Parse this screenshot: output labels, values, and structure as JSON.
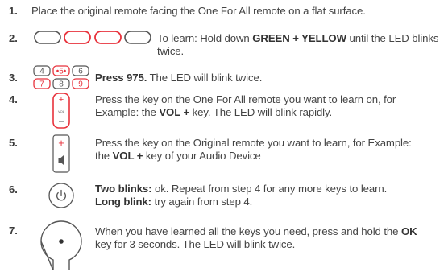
{
  "colors": {
    "accent": "#e8323c",
    "outline": "#555555",
    "text": "#444444"
  },
  "steps": [
    {
      "num": "1.",
      "text": "Place the original remote facing the One For All remote on a flat surface."
    },
    {
      "num": "2.",
      "text_a": "To learn: Hold down ",
      "bold_a": "GREEN + YELLOW",
      "text_b": " until the LED blinks twice.",
      "icon": "color-keys-icon"
    },
    {
      "num": "3.",
      "bold_a": "Press 975.",
      "text_b": " The LED will blink twice.",
      "keypad": [
        "4",
        "5",
        "6",
        "7",
        "8",
        "9"
      ],
      "icon": "number-keypad-icon"
    },
    {
      "num": "4.",
      "text_a": "Press the key on the One For All remote you want to learn on, for Example: the ",
      "bold_a": "VOL +",
      "text_b": " key. The LED will blink rapidly.",
      "icon": "volume-rocker-icon",
      "icon_labels": [
        "+",
        "VOL",
        "–"
      ]
    },
    {
      "num": "5.",
      "text_a": "Press the key on the Original remote you want to learn, for Example: the ",
      "bold_a": "VOL +",
      "text_b": " key of your Audio Device",
      "icon": "volume-speaker-key-icon",
      "icon_labels": [
        "+"
      ]
    },
    {
      "num": "6.",
      "bold_a": "Two blinks:",
      "text_a": " ok. Repeat from step 4 for any more keys to learn.",
      "bold_b": "Long blink:",
      "text_b": " try again from step 4.",
      "icon": "power-key-icon"
    },
    {
      "num": "7.",
      "text_a": "When you have learned all the keys you need, press and hold the ",
      "bold_a": "OK",
      "text_b": " key for 3 seconds. The LED will blink twice.",
      "icon": "ok-key-icon"
    }
  ]
}
